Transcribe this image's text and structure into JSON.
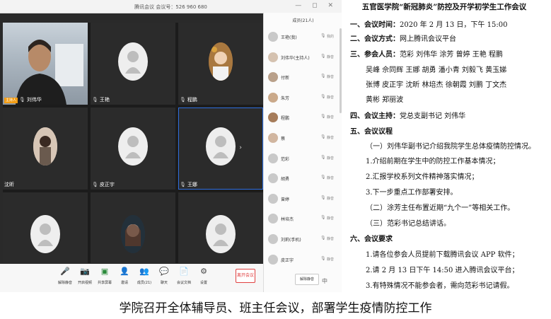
{
  "window": {
    "title": "腾讯会议 会议号：526 960 680",
    "controls": "— ◻ ✕"
  },
  "video_tiles": [
    {
      "name": "刘伟华",
      "host_badge": "主持人"
    },
    {
      "name": "王艳"
    },
    {
      "name": "程鹏"
    },
    {
      "name": "沈昕"
    },
    {
      "name": "皮正宇"
    },
    {
      "name": "王娜"
    },
    {
      "name": ""
    },
    {
      "name": ""
    },
    {
      "name": ""
    }
  ],
  "toolbar": {
    "items": [
      {
        "label": "解除静音",
        "icon": "mic-muted-icon"
      },
      {
        "label": "开启视频",
        "icon": "camera-off-icon"
      },
      {
        "label": "共享屏幕",
        "icon": "share-screen-icon"
      },
      {
        "label": "邀请",
        "icon": "invite-icon"
      },
      {
        "label": "成员(21)",
        "icon": "members-icon"
      },
      {
        "label": "聊天",
        "icon": "chat-icon"
      },
      {
        "label": "会议文档",
        "icon": "document-icon"
      },
      {
        "label": "设置",
        "icon": "settings-icon"
      }
    ],
    "end_label": "离开会议"
  },
  "members_panel": {
    "title": "成员(21人)",
    "mute_button": "解除静音",
    "chat_button": "中",
    "members": [
      {
        "name": "王艳(我)",
        "status": "我的"
      },
      {
        "name": "刘伟华(主持人)",
        "status": "静音"
      },
      {
        "name": "付新",
        "status": "静音"
      },
      {
        "name": "朱芳",
        "status": "静音"
      },
      {
        "name": "程鹏",
        "status": "静音"
      },
      {
        "name": "蔡",
        "status": "静音"
      },
      {
        "name": "范彩",
        "status": "静音"
      },
      {
        "name": "胡勇",
        "status": "静音"
      },
      {
        "name": "曾婷",
        "status": "静音"
      },
      {
        "name": "林培杰",
        "status": "静音"
      },
      {
        "name": "刘莉(手机)",
        "status": "静音"
      },
      {
        "name": "皮正宇",
        "status": "静音"
      }
    ]
  },
  "notice": {
    "title": "五官医学院“新冠肺炎”防控及开学初学生工作会议",
    "time_label": "一、会议时间：",
    "time_value": "2020 年 2 月 13 日，下午 15:00",
    "mode_label": "二、会议方式：",
    "mode_value": "网上腾讯会议平台",
    "attendees_label": "三、参会人员：",
    "attendees_lines": [
      "范彩  刘伟华  涂芳  曾婷  王艳  程鹏",
      "吴峰  佘同辉  王娜  胡勇  潘小青  刘毅飞  黄玉娣",
      "张博  皮正宇  沈昕  林培杰 徐朝霞  刘鹏  丁文杰",
      "黄彬  郑丽波"
    ],
    "chair_label": "四、会议主持：",
    "chair_value": "党总支副书记  刘伟华",
    "agenda_label": "五、会议议程",
    "agenda_lines": [
      "（一）刘伟华副书记介绍我院学生总体疫情防控情况。",
      "1.介绍前期在学生中的防控工作基本情况；",
      "2.汇报学校系列文件精神落实情况；",
      "3.下一步重点工作部署安排。",
      "（二）涂芳主任布置近期“九个一”等相关工作。",
      "（三）范彩书记总结讲话。"
    ],
    "requirements_label": "六、会议要求",
    "requirements_lines": [
      "1.请各位参会人员提前下载腾讯会议 APP 软件；",
      "2.请 2 月 13 日下午 14:50 进入腾讯会议平台；",
      "3.有特殊情况不能参会者，需向范彩书记请假。"
    ]
  },
  "caption": "学院召开全体辅导员、班主任会议，部署学生疫情防控工作"
}
